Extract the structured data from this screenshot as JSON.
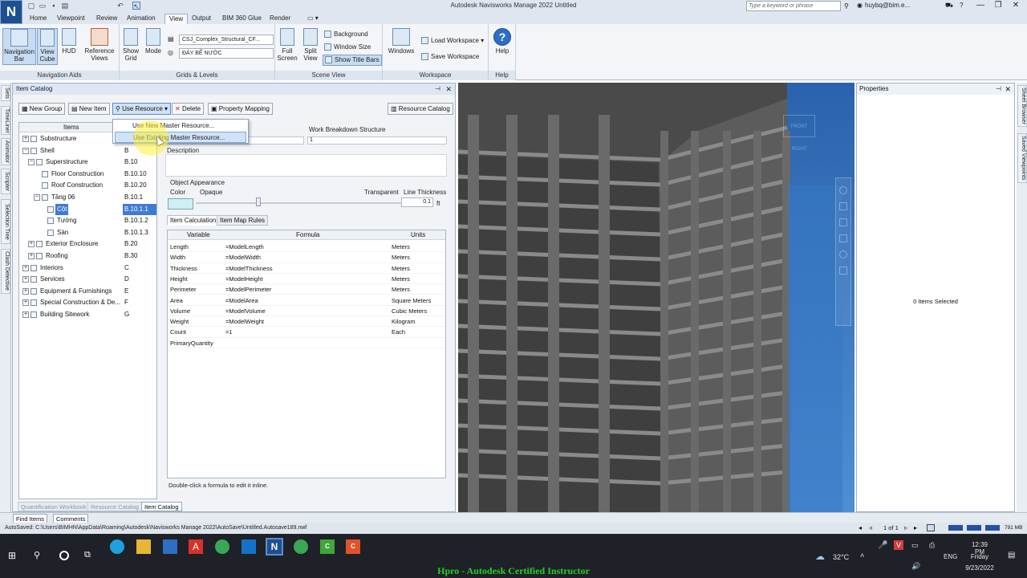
{
  "window": {
    "title": "Autodesk Navisworks Manage 2022    Untitled",
    "logo_letter": "N",
    "search_placeholder": "Type a keyword or phrase",
    "user": "huybq@bim.e...",
    "min": "—",
    "max": "❐",
    "close": "✕"
  },
  "tabs": [
    "Home",
    "Viewpoint",
    "Review",
    "Animation",
    "View",
    "Output",
    "BIM 360 Glue",
    "Render"
  ],
  "active_tab": "View",
  "ribbon": {
    "nav_aids": {
      "title": "Navigation Aids",
      "navigation_bar": "Navigation Bar",
      "view_cube": "View Cube",
      "hud": "HUD",
      "reference_views": "Reference Views"
    },
    "grids": {
      "title": "Grids & Levels",
      "show_grid": "Show Grid",
      "mode": "Mode",
      "model_combo": "CSJ_Complex_Structural_CF...",
      "level_combo": "ĐÁY BỂ NƯỚC"
    },
    "scene": {
      "title": "Scene View",
      "full_screen": "Full Screen",
      "split_view": "Split View",
      "background": "Background",
      "window_size": "Window Size",
      "show_title_bars": "Show Title Bars"
    },
    "workspace": {
      "title": "Workspace",
      "windows": "Windows",
      "load_workspace": "Load Workspace",
      "save_workspace": "Save Workspace"
    },
    "help": {
      "title": "Help",
      "help": "Help"
    }
  },
  "left_tabs": [
    "Sets",
    "TimeLiner",
    "Animator",
    "Scripter",
    "Selection Tree",
    "Clash Detective"
  ],
  "right_tabs": [
    "Sheet Browser",
    "Saved Viewpoints"
  ],
  "catalog": {
    "title": "Item Catalog",
    "toolbar": {
      "new_group": "New Group",
      "new_item": "New Item",
      "use_resource": "Use Resource",
      "delete": "Delete",
      "property_mapping": "Property Mapping",
      "resource_catalog": "Resource Catalog"
    },
    "dropdown": [
      "Use New Master Resource...",
      "Use Existing Master Resource..."
    ],
    "tree_header": "Items",
    "tree": [
      {
        "name": "Substructure",
        "code": "A",
        "level": 0,
        "exp": "+",
        "selected": false
      },
      {
        "name": "Shell",
        "code": "B",
        "level": 0,
        "exp": "−",
        "selected": false
      },
      {
        "name": "Superstructure",
        "code": "B.10",
        "level": 1,
        "exp": "−",
        "selected": false
      },
      {
        "name": "Floor Construction",
        "code": "B.10.10",
        "level": 2,
        "exp": "",
        "selected": false
      },
      {
        "name": "Roof Construction",
        "code": "B.10.20",
        "level": 2,
        "exp": "",
        "selected": false
      },
      {
        "name": "Tầng 06",
        "code": "B.10.1",
        "level": 2,
        "exp": "−",
        "selected": false
      },
      {
        "name": "Cột",
        "code": "B.10.1.1",
        "level": 3,
        "exp": "",
        "selected": true
      },
      {
        "name": "Tường",
        "code": "B.10.1.2",
        "level": 3,
        "exp": "",
        "selected": false
      },
      {
        "name": "Sàn",
        "code": "B.10.1.3",
        "level": 3,
        "exp": "",
        "selected": false
      },
      {
        "name": "Exterior Enclosure",
        "code": "B.20",
        "level": 1,
        "exp": "+",
        "selected": false
      },
      {
        "name": "Roofing",
        "code": "B.30",
        "level": 1,
        "exp": "+",
        "selected": false
      },
      {
        "name": "Interiors",
        "code": "C",
        "level": 0,
        "exp": "+",
        "selected": false
      },
      {
        "name": "Services",
        "code": "D",
        "level": 0,
        "exp": "+",
        "selected": false
      },
      {
        "name": "Equipment & Furnishings",
        "code": "E",
        "level": 0,
        "exp": "+",
        "selected": false
      },
      {
        "name": "Special Construction & De...",
        "code": "F",
        "level": 0,
        "exp": "+",
        "selected": false
      },
      {
        "name": "Building Sitework",
        "code": "G",
        "level": 0,
        "exp": "+",
        "selected": false
      }
    ],
    "wbs_label": "Work Breakdown Structure",
    "wbs_value": "1",
    "description_label": "Description",
    "appearance": {
      "title": "Object Appearance",
      "color": "Color",
      "opaque": "Opaque",
      "transparent": "Transparent",
      "line_thickness": "Line Thickness",
      "thickness_value": "0.1",
      "unit": "ft",
      "transparency": 0.3
    },
    "inner_tabs": [
      "Item Calculations",
      "Item Map Rules"
    ],
    "calc_headers": [
      "Variable",
      "Formula",
      "Units"
    ],
    "calc_rows": [
      {
        "variable": "Length",
        "formula": "=ModelLength",
        "units": "Meters"
      },
      {
        "variable": "Width",
        "formula": "=ModelWidth",
        "units": "Meters"
      },
      {
        "variable": "Thickness",
        "formula": "=ModelThickness",
        "units": "Meters"
      },
      {
        "variable": "Height",
        "formula": "=ModelHeight",
        "units": "Meters"
      },
      {
        "variable": "Perimeter",
        "formula": "=ModelPerimeter",
        "units": "Meters"
      },
      {
        "variable": "Area",
        "formula": "=ModelArea",
        "units": "Square Meters"
      },
      {
        "variable": "Volume",
        "formula": "=ModelVolume",
        "units": "Cubic Meters"
      },
      {
        "variable": "Weight",
        "formula": "=ModelWeight",
        "units": "Kilogram"
      },
      {
        "variable": "Count",
        "formula": "=1",
        "units": "Each"
      },
      {
        "variable": "PrimaryQuantity",
        "formula": "",
        "units": ""
      }
    ],
    "hint": "Double-click a formula to edit it inline.",
    "bottom_tabs": [
      "Quantification Workbook",
      "Resource Catalog",
      "Item Catalog"
    ]
  },
  "properties": {
    "title": "Properties",
    "empty": "0 Items Selected"
  },
  "viewcube": {
    "front": "FRONT",
    "right": "RIGHT"
  },
  "status": {
    "tabs": [
      "Find Items",
      "Comments"
    ],
    "autosave": "AutoSaved: C:\\Users\\BIMHN\\AppData\\Roaming\\Autodesk\\Navisworks Manage 2022\\AutoSave\\Untitled.Autosave189.nwf",
    "page": "1 of 1",
    "memory": "791 MB"
  },
  "taskbar": {
    "temp": "32°C",
    "lang": "ENG",
    "time": "12:39 PM",
    "day": "Friday",
    "date": "9/23/2022"
  },
  "banner": "Hpro - Autodesk Certified Instructor"
}
